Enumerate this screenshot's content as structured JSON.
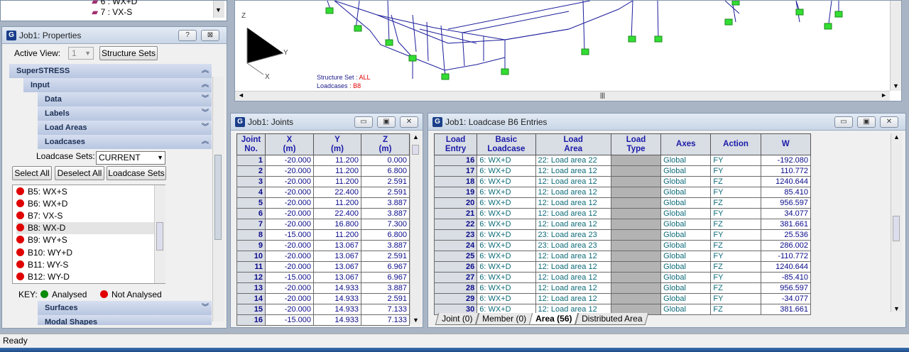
{
  "tree_top": {
    "item1": "6 : WX+D",
    "item2": "7 : VX-S"
  },
  "properties": {
    "title": "Job1: Properties",
    "help_btn": "?",
    "close_btn": "⊠",
    "active_view_label": "Active View:",
    "active_view_value": "1",
    "structure_sets_btn": "Structure Sets",
    "tree": {
      "superstress": "SuperSTRESS",
      "input": "Input",
      "data": "Data",
      "labels": "Labels",
      "load_areas": "Load Areas",
      "loadcases": "Loadcases",
      "surfaces": "Surfaces",
      "modal_shapes": "Modal Shapes"
    },
    "loadcase_sets_label": "Loadcase Sets:",
    "loadcase_sets_value": "CURRENT",
    "select_all": "Select All",
    "deselect_all": "Deselect All",
    "loadcase_sets_btn": "Loadcase Sets",
    "loadcases": [
      {
        "id": "B5:",
        "name": "WX+S"
      },
      {
        "id": "B6:",
        "name": "WX+D"
      },
      {
        "id": "B7:",
        "name": "VX-S"
      },
      {
        "id": "B8:",
        "name": "WX-D"
      },
      {
        "id": "B9:",
        "name": "WY+S"
      },
      {
        "id": "B10:",
        "name": "WY+D"
      },
      {
        "id": "B11:",
        "name": "WY-S"
      },
      {
        "id": "B12:",
        "name": "WY-D"
      }
    ],
    "key_label": "KEY:",
    "analysed": "Analysed",
    "not_analysed": "Not Analysed",
    "colors": {
      "analysed": "#0a8a0a",
      "not_analysed": "#e00000"
    }
  },
  "view3d": {
    "axis_z": "Z",
    "axis_y": "Y",
    "axis_x": "X",
    "structure_set_label": "Structure Set :",
    "structure_set_value": "ALL",
    "loadcases_label": "Loadcases",
    "loadcases_value": ": B8"
  },
  "joints": {
    "title": "Job1: Joints",
    "headers": {
      "no": "Joint\nNo.",
      "x": "X\n(m)",
      "y": "Y\n(m)",
      "z": "Z\n(m)"
    },
    "rows": [
      [
        "1",
        "-20.000",
        "11.200",
        "0.000"
      ],
      [
        "2",
        "-20.000",
        "11.200",
        "6.800"
      ],
      [
        "3",
        "-20.000",
        "11.200",
        "2.591"
      ],
      [
        "4",
        "-20.000",
        "22.400",
        "2.591"
      ],
      [
        "5",
        "-20.000",
        "11.200",
        "3.887"
      ],
      [
        "6",
        "-20.000",
        "22.400",
        "3.887"
      ],
      [
        "7",
        "-20.000",
        "16.800",
        "7.300"
      ],
      [
        "8",
        "-15.000",
        "11.200",
        "6.800"
      ],
      [
        "9",
        "-20.000",
        "13.067",
        "3.887"
      ],
      [
        "10",
        "-20.000",
        "13.067",
        "2.591"
      ],
      [
        "11",
        "-20.000",
        "13.067",
        "6.967"
      ],
      [
        "12",
        "-15.000",
        "13.067",
        "6.967"
      ],
      [
        "13",
        "-20.000",
        "14.933",
        "3.887"
      ],
      [
        "14",
        "-20.000",
        "14.933",
        "2.591"
      ],
      [
        "15",
        "-20.000",
        "14.933",
        "7.133"
      ],
      [
        "16",
        "-15.000",
        "14.933",
        "7.133"
      ]
    ]
  },
  "loadcase": {
    "title": "Job1: Loadcase B6 Entries",
    "headers": {
      "entry": "Load\nEntry",
      "basic": "Basic\nLoadcase",
      "area": "Load\nArea",
      "type": "Load\nType",
      "axes": "Axes",
      "action": "Action",
      "w": "W"
    },
    "rows": [
      [
        "16",
        "6: WX+D",
        "22: Load area 22",
        "Global",
        "FY",
        "-192.080"
      ],
      [
        "17",
        "6: WX+D",
        "12: Load area 12",
        "Global",
        "FY",
        "110.772"
      ],
      [
        "18",
        "6: WX+D",
        "12: Load area 12",
        "Global",
        "FZ",
        "1240.644"
      ],
      [
        "19",
        "6: WX+D",
        "12: Load area 12",
        "Global",
        "FY",
        "85.410"
      ],
      [
        "20",
        "6: WX+D",
        "12: Load area 12",
        "Global",
        "FZ",
        "956.597"
      ],
      [
        "21",
        "6: WX+D",
        "12: Load area 12",
        "Global",
        "FY",
        "34.077"
      ],
      [
        "22",
        "6: WX+D",
        "12: Load area 12",
        "Global",
        "FZ",
        "381.661"
      ],
      [
        "23",
        "6: WX+D",
        "23: Load area 23",
        "Global",
        "FY",
        "25.536"
      ],
      [
        "24",
        "6: WX+D",
        "23: Load area 23",
        "Global",
        "FZ",
        "286.002"
      ],
      [
        "25",
        "6: WX+D",
        "12: Load area 12",
        "Global",
        "FY",
        "-110.772"
      ],
      [
        "26",
        "6: WX+D",
        "12: Load area 12",
        "Global",
        "FZ",
        "1240.644"
      ],
      [
        "27",
        "6: WX+D",
        "12: Load area 12",
        "Global",
        "FY",
        "-85.410"
      ],
      [
        "28",
        "6: WX+D",
        "12: Load area 12",
        "Global",
        "FZ",
        "956.597"
      ],
      [
        "29",
        "6: WX+D",
        "12: Load area 12",
        "Global",
        "FY",
        "-34.077"
      ],
      [
        "30",
        "6: WX+D",
        "12: Load area 12",
        "Global",
        "FZ",
        "381.661"
      ]
    ],
    "tabs": [
      "Joint (0)",
      "Member (0)",
      "Area (56)",
      "Distributed Area"
    ]
  },
  "statusbar": {
    "text": "Ready"
  }
}
